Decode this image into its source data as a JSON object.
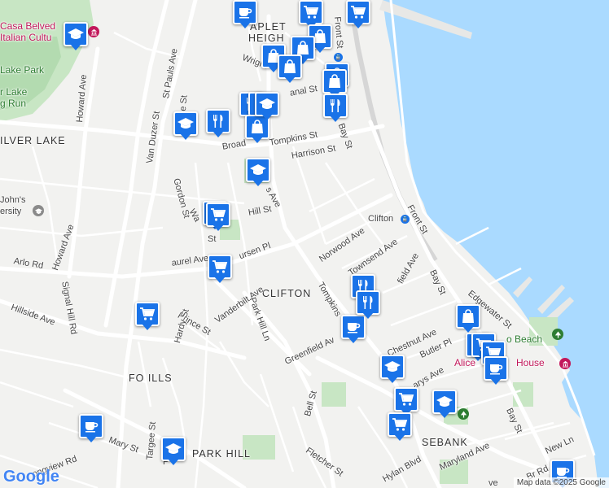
{
  "map": {
    "area_labels": {
      "silver_lake": "ILVER LAKE",
      "clifton": "CLIFTON",
      "fox_hills": "FO   ILLS",
      "park_hill": "PARK HILL",
      "rosebank": "SEBANK",
      "heights": "HEIGH",
      "apleton": "APLET"
    },
    "poi_labels": {
      "casa_belvedere": "Casa Belved",
      "italian_culture": "Italian Cultu",
      "st_johns": "John's",
      "university": "ersity",
      "alice_austen": "Alice",
      "alice_house": "House",
      "beach": "o Beach",
      "lake_park": "Lake Park",
      "run": "g Run",
      "r_lake": "r Lake",
      "clifton_station": "Clifton"
    },
    "streets": {
      "front_st_top": "Front St",
      "front_st_mid": "Front St",
      "bay_st_top": "Bay St",
      "bay_st_mid": "Bay St",
      "bay_st_bottom": "Bay St",
      "st_pauls": "St Pauls Ave",
      "van_duzer": "Van Duzer St",
      "howard_top": "Howard Ave",
      "howard_mid": "Howard Ave",
      "targee_top": "argee St",
      "targee_bottom": "Targee St",
      "gordon": "Gordon St",
      "broad": "Broad",
      "tompkins_st": "Tompkins St",
      "harrison": "Harrison St",
      "hill_st": "Hill St",
      "wright": "Wright",
      "canal": "anal St",
      "norwood": "Norwood Ave",
      "townsend": "Townsend Ave",
      "field_ave": "field Ave",
      "vanderbilt": "Vanderbilt Ave",
      "tompkins_ave": "Tompkins",
      "park_hill_ln": "Park Hill Ln",
      "dursen": "ursen Pl",
      "laurel": "aurel Ave",
      "arlo": "Arlo Rd",
      "signal_hill": "Signal Hill Rd",
      "hillside": "Hillside Ave",
      "prince": "Prince St",
      "hardy": "Hardy St",
      "greenfield": "Greenfield Av",
      "chestnut": "Chestnut Ave",
      "butler": "Butler Pl",
      "marys": "arys Ave",
      "edgewater": "Edgewater St",
      "bell": "Bell St",
      "fletcher": "Fletcher St",
      "hylan": "Hylan Blvd",
      "maryland": "Maryland Ave",
      "mary": "Mary St",
      "longview": "ongview Rd",
      "new_ln": "New Ln",
      "br_rd": "Br Rd",
      "p_ave": "P",
      "ave_bottom": "ve",
      "waverly": "Wa",
      "ave_label": "s Ave",
      "st_small": "St",
      "wa_small": "Wa"
    },
    "pins": [
      {
        "icon": "coffee-icon",
        "category": "cafe"
      },
      {
        "icon": "cart-icon",
        "category": "grocery"
      },
      {
        "icon": "school-icon",
        "category": "school"
      },
      {
        "icon": "bag-icon",
        "category": "store"
      },
      {
        "icon": "cart-icon",
        "category": "grocery"
      },
      {
        "icon": "bag-icon",
        "category": "store"
      },
      {
        "icon": "bag-icon",
        "category": "store"
      },
      {
        "icon": "bag-icon",
        "category": "store"
      },
      {
        "icon": "bag-icon",
        "category": "store"
      },
      {
        "icon": "bag-icon",
        "category": "store"
      },
      {
        "icon": "fork-knife-icon",
        "category": "restaurant"
      },
      {
        "icon": "fork-knife-icon",
        "category": "restaurant"
      },
      {
        "icon": "fork-knife-icon",
        "category": "restaurant"
      },
      {
        "icon": "school-icon",
        "category": "school"
      },
      {
        "icon": "fork-knife-icon",
        "category": "restaurant"
      },
      {
        "icon": "bag-icon",
        "category": "store"
      },
      {
        "icon": "school-icon",
        "category": "school"
      },
      {
        "icon": "school-icon",
        "category": "school"
      },
      {
        "icon": "school-icon",
        "category": "school"
      },
      {
        "icon": "cart-icon",
        "category": "grocery"
      },
      {
        "icon": "cart-icon",
        "category": "grocery"
      },
      {
        "icon": "cart-icon",
        "category": "grocery"
      },
      {
        "icon": "coffee-icon",
        "category": "cafe"
      },
      {
        "icon": "fork-knife-icon",
        "category": "restaurant"
      },
      {
        "icon": "fork-knife-icon",
        "category": "restaurant"
      },
      {
        "icon": "coffee-icon",
        "category": "cafe"
      },
      {
        "icon": "bag-icon",
        "category": "store"
      },
      {
        "icon": "cart-icon",
        "category": "grocery"
      },
      {
        "icon": "cart-icon",
        "category": "grocery"
      },
      {
        "icon": "coffee-icon",
        "category": "cafe"
      },
      {
        "icon": "school-icon",
        "category": "school"
      },
      {
        "icon": "cart-icon",
        "category": "grocery"
      },
      {
        "icon": "school-icon",
        "category": "school"
      },
      {
        "icon": "cart-icon",
        "category": "grocery"
      },
      {
        "icon": "coffee-icon",
        "category": "cafe"
      },
      {
        "icon": "school-icon",
        "category": "school"
      },
      {
        "icon": "coffee-icon",
        "category": "cafe"
      }
    ],
    "google_logo": "Google",
    "attribution": "Map data ©2025 Google",
    "colors": {
      "water": "#aadaff",
      "land": "#f2f2f0",
      "park": "#c8e6c4",
      "pin": "#1a73e8",
      "poi_museum": "#c2185b",
      "poi_park": "#2e7d32"
    }
  }
}
